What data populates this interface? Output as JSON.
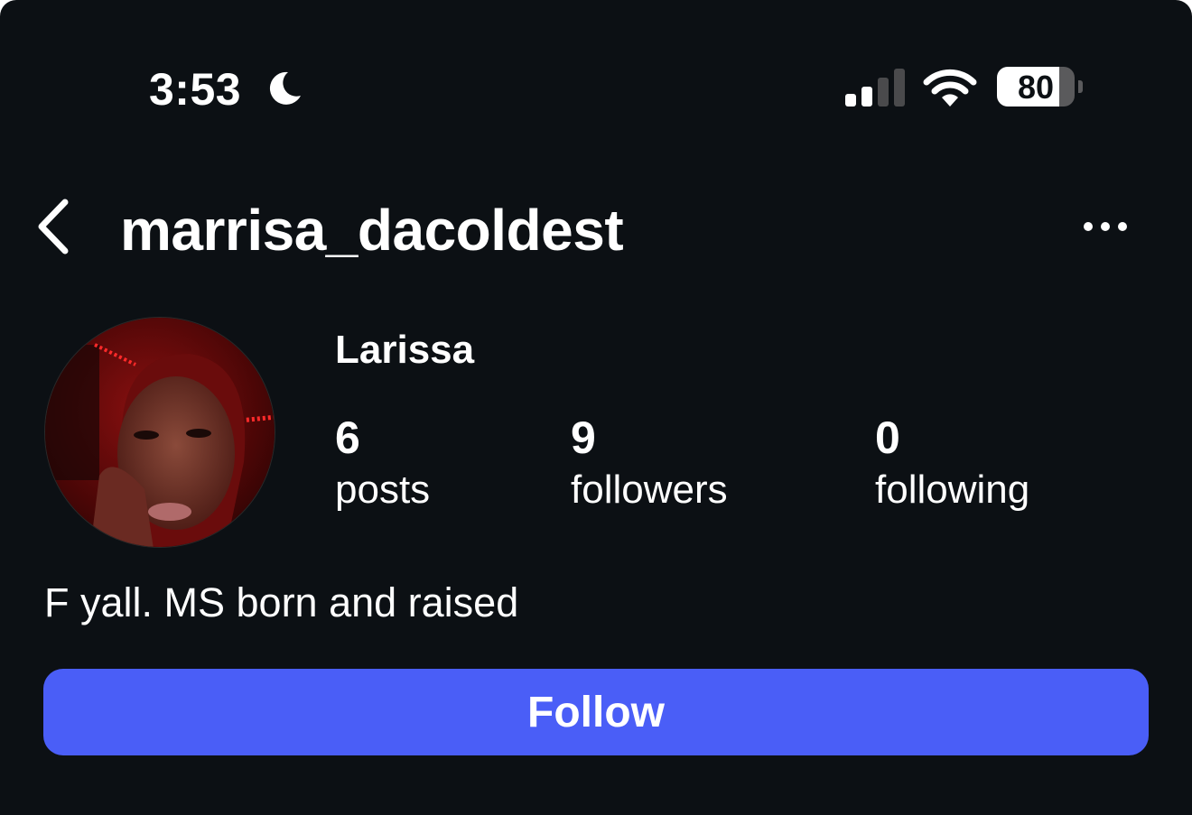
{
  "status_bar": {
    "time": "3:53",
    "battery_level": "80",
    "battery_fraction": 0.8,
    "icons": [
      "moon-icon",
      "signal-icon",
      "wifi-icon",
      "battery-icon"
    ]
  },
  "header": {
    "username": "marrisa_dacoldest",
    "back_icon": "chevron-left-icon",
    "more_icon": "more-horizontal-icon"
  },
  "profile": {
    "display_name": "Larissa",
    "stats": {
      "posts": {
        "count": "6",
        "label": "posts"
      },
      "followers": {
        "count": "9",
        "label": "followers"
      },
      "following": {
        "count": "0",
        "label": "following"
      }
    },
    "bio": "F yall. MS born and raised"
  },
  "actions": {
    "follow_label": "Follow"
  },
  "colors": {
    "background": "#0c1014",
    "accent": "#4a5ef7",
    "text": "#ffffff"
  }
}
